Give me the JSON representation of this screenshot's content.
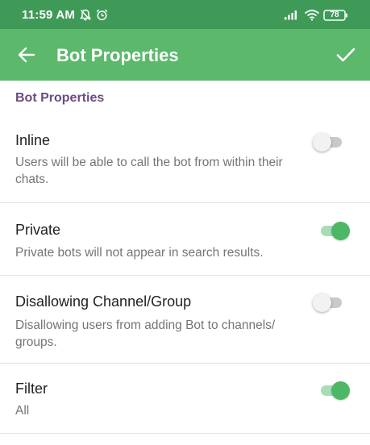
{
  "statusbar": {
    "time": "11:59 AM",
    "battery": "78",
    "icons": [
      "muted-bell-icon",
      "alarm-clock-icon",
      "signal-icon",
      "wifi-icon",
      "battery-icon"
    ]
  },
  "toolbar": {
    "title": "Bot Properties",
    "back_icon": "arrow-left-icon",
    "done_icon": "checkmark-icon"
  },
  "section": {
    "header": "Bot Properties"
  },
  "colors": {
    "statusbar": "#3f9a58",
    "toolbar": "#5cb86b",
    "section_header": "#6a4c80",
    "toggle_on": "#4cb866"
  },
  "settings": [
    {
      "title": "Inline",
      "desc_line1": "Users will be able to call the bot from within their",
      "desc_line2": "chats.",
      "enabled": false
    },
    {
      "title": "Private",
      "desc_line1": "Private bots will not appear in search results.",
      "enabled": true
    },
    {
      "title": "Disallowing Channel/Group",
      "desc_line1": "Disallowing users from adding Bot to channels/",
      "desc_line2": "groups.",
      "enabled": false
    },
    {
      "title": "Filter",
      "desc_line1": "All",
      "enabled": true
    }
  ]
}
